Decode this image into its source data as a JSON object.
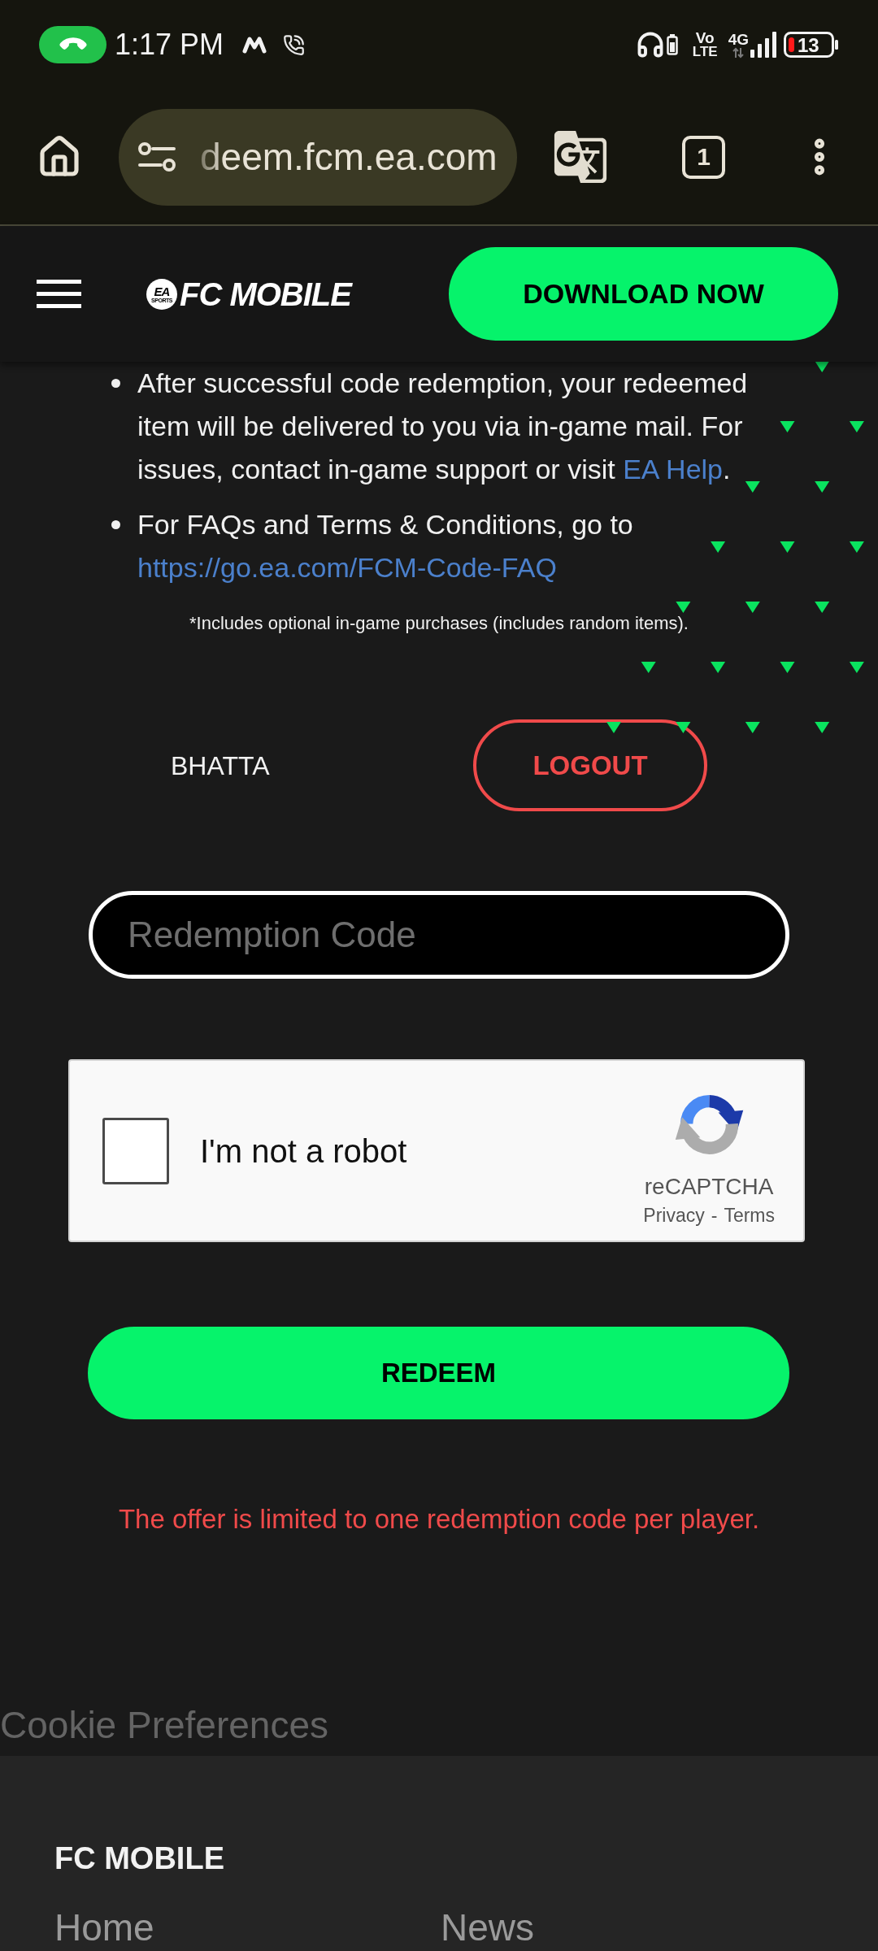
{
  "status_bar": {
    "time": "1:17 PM",
    "volte_top": "Vo",
    "volte_bottom": "LTE",
    "network": "4G",
    "battery": "13"
  },
  "browser": {
    "url": "deem.fcm.ea.com",
    "tab_count": "1"
  },
  "header": {
    "logo": {
      "badge_top": "EA",
      "badge_bottom": "SPORTS",
      "wordmark": "FC MOBILE"
    },
    "download_button": "DOWNLOAD NOW"
  },
  "notes": [
    {
      "text": "After successful code redemption, your redeemed item will be delivered to you via in-game mail. For issues, contact in-game support or visit ",
      "link": "EA Help",
      "text_after": "."
    },
    {
      "text": "For FAQs and Terms & Conditions, go to ",
      "link": "https://go.ea.com/FCM-Code-FAQ"
    }
  ],
  "footnote": "*Includes optional in-game purchases (includes random items).",
  "account": {
    "username": "BHATTA",
    "logout_button": "LOGOUT"
  },
  "redemption_field": {
    "placeholder": "Redemption Code"
  },
  "captcha": {
    "label": "I'm not a robot",
    "checked": false,
    "brand": "reCAPTCHA",
    "links": [
      "Privacy",
      "Terms"
    ],
    "separator": "-"
  },
  "redeem_button": "REDEEM",
  "notice": "The offer is limited to one redemption code per player.",
  "cookie_link": "Cookie Preferences",
  "footer": {
    "title": "FC MOBILE",
    "links": [
      "Home",
      "News"
    ]
  }
}
